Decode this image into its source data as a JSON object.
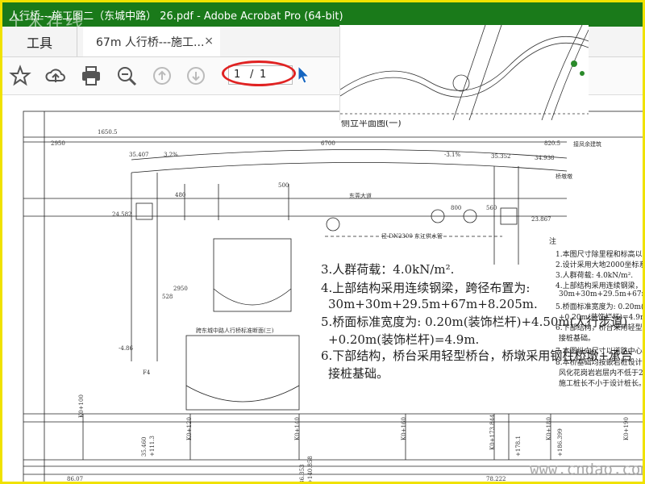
{
  "window": {
    "title": "人行桥---施工图二（东城中路） 26.pdf - Adobe Acrobat Pro (64-bit)"
  },
  "tabs": {
    "tools_label": "工具",
    "doc_tab_label": "67m 人行桥---施工...",
    "close_glyph": "×"
  },
  "toolbar": {
    "icons": [
      "star-icon",
      "cloud-upload-icon",
      "print-icon",
      "zoom-search-icon",
      "page-up-icon",
      "page-down-icon",
      "select-cursor-icon"
    ],
    "page_current": "1",
    "page_separator": "/",
    "page_total": "1",
    "more_glyph": "•••"
  },
  "drawing": {
    "dims_top": [
      "1650.5",
      "2950",
      "6700",
      "820.5"
    ],
    "elev_labels": [
      "35.407",
      "35.352",
      "34.938",
      "24.582",
      "23.867",
      "-4.86"
    ],
    "slope_labels": [
      "3.2%",
      "-3.1%"
    ],
    "road_labels": [
      "东莞大道",
      "接凤余建筑",
      "桥墩墩"
    ],
    "pipe_label": "径 DN2300 东江供水管",
    "vertical_dims": [
      "480",
      "500",
      "2950",
      "528",
      "800",
      "560"
    ],
    "section_title": "跨东城中路人行桥标准断面(三)",
    "header_fragment": "侧立平面图(一)",
    "notes": [
      "3.人群荷载：4.0kN/m².",
      "4.上部结构采用连续钢梁，跨径布置为:",
      "30m+30m+29.5m+67m+8.205m.",
      "5.桥面标准宽度为: 0.20m(装饰栏杆)+4.50m(人行步道)",
      "+0.20m(装饰栏杆)=4.9m.",
      "6.下部结构，桥台采用轻型桥台，桥墩采用钢柱桥墩+承台",
      "接桩基础。"
    ],
    "right_notes_title": "注",
    "right_notes": [
      "1.本图尺寸除里程和标高以米计外",
      "2.设计采用大地2000坐标系统，黄",
      "3.人群荷载: 4.0kN/m².",
      "4.上部结构采用连续钢梁，跨径布",
      "30m+30m+29.5m+67m+8.205m.",
      "5.桥面标准宽度为: 0.20m(装饰栏",
      "+0.20m(装饰栏杆)=4.9m.",
      "6.下部结构，桥台采用轻型桥台，",
      "接桩基础。",
      "7.本图纵向尺寸以道路中心线为",
      "8.本桥基础均按嵌岩桩设计，施工",
      "风化花岗岩岩层内不低于2d（d为",
      "施工桩长不小于设计桩长。"
    ],
    "stations": [
      "K0+100",
      "K0+120",
      "K0+140",
      "K0+160",
      "K0+173.844",
      "K0+180",
      "K0+190"
    ],
    "bottom_values": [
      "36.353",
      "+140.858",
      "35.460",
      "+111.3",
      "+178.1",
      "+186.399",
      "86.07",
      "78.222"
    ],
    "ground_label": "F4"
  },
  "watermarks": {
    "top": "土木在线",
    "bottom": "www.cndao.com"
  },
  "colors": {
    "titlebar": "#1a7a1a",
    "frame": "#f0e200",
    "ring": "#e02222",
    "cursor": "#1565c0"
  }
}
